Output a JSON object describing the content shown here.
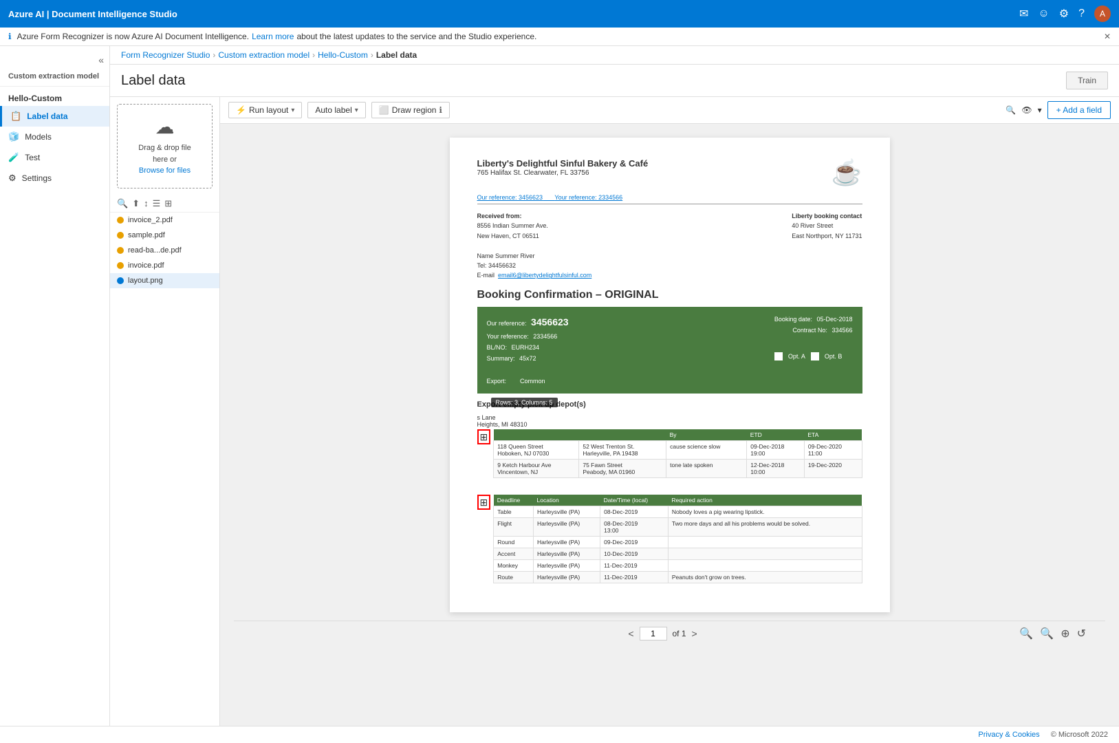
{
  "app": {
    "title": "Azure AI | Document Intelligence Studio",
    "top_icons": [
      "📧",
      "😊",
      "⚙",
      "?"
    ]
  },
  "notification": {
    "info_icon": "ℹ",
    "text": "Azure Form Recognizer is now Azure AI Document Intelligence.",
    "link_text": "Learn more",
    "link_suffix": "about the latest updates to the service and the Studio experience."
  },
  "breadcrumb": {
    "items": [
      "Form Recognizer Studio",
      "Custom extraction model",
      "Hello-Custom",
      "Label data"
    ]
  },
  "page": {
    "title": "Label data",
    "train_btn": "Train"
  },
  "sidebar": {
    "collapse_icon": "«",
    "section_label": "Custom extraction model",
    "project_name": "Hello-Custom",
    "nav_items": [
      {
        "id": "label-data",
        "label": "Label data",
        "icon": "📋",
        "active": true
      },
      {
        "id": "models",
        "label": "Models",
        "icon": "🧊",
        "active": false
      },
      {
        "id": "test",
        "label": "Test",
        "icon": "🧪",
        "active": false
      },
      {
        "id": "settings",
        "label": "Settings",
        "icon": "⚙",
        "active": false
      }
    ]
  },
  "file_panel": {
    "upload": {
      "icon": "☁",
      "line1": "Drag & drop file",
      "line2": "here or",
      "link": "Browse for files"
    },
    "tools": [
      "🔍",
      "⬆",
      "↕",
      "☰",
      "⊞"
    ],
    "files": [
      {
        "name": "invoice_2.pdf",
        "dot": "orange",
        "active": false
      },
      {
        "name": "sample.pdf",
        "dot": "orange",
        "active": false
      },
      {
        "name": "read-ba...de.pdf",
        "dot": "orange",
        "active": false
      },
      {
        "name": "invoice.pdf",
        "dot": "orange",
        "active": false
      },
      {
        "name": "layout.png",
        "dot": "blue",
        "active": true
      }
    ]
  },
  "toolbar": {
    "run_layout_btn": "Run layout",
    "auto_label_btn": "Auto label",
    "draw_region_btn": "Draw region",
    "info_icon": "ℹ",
    "chevron": "▾",
    "search_icon": "🔍",
    "eye_icon": "👁",
    "add_field_btn": "+ Add a field"
  },
  "document": {
    "company_name": "Liberty's Delightful Sinful Bakery & Café",
    "address": "765 Halifax St. Clearwater, FL 33756",
    "our_ref_label": "Our reference: 3456623",
    "your_ref_label": "Your reference: 2334566",
    "received_from": "Received from:",
    "from_addr1": "8556 Indian Summer Ave.",
    "from_addr2": "New Haven, CT 06511",
    "name_label": "Name Summer River",
    "tel_label": "Tel: 34456632",
    "email_label": "E-mail",
    "email_link": "email6@libertydelightfulsinful.com",
    "liberty_contact": "Liberty booking contact",
    "liberty_addr1": "40 River Street",
    "liberty_addr2": "East Northport, NY 11731",
    "booking_title": "Booking Confirmation – ORIGINAL",
    "green_box": {
      "our_ref_label": "Our reference:",
      "our_ref_val": "3456623",
      "your_ref_label": "Your reference:",
      "your_ref_val": "2334566",
      "bl_no_label": "BL/NO:",
      "bl_no_val": "EURH234",
      "summary_label": "Summary:",
      "summary_val": "45x72",
      "booking_date_label": "Booking date:",
      "booking_date_val": "05-Dec-2018",
      "contract_no_label": "Contract No:",
      "contract_no_val": "334566",
      "export_label": "Export:",
      "export_val": "Common",
      "opt_a": "Opt. A",
      "opt_b": "Opt. B"
    },
    "export_section": "Export empty pick up depot(s)",
    "tooltip_text": "Rows: 3, Columns: 5",
    "table1": {
      "headers": [
        "",
        "",
        "By",
        "ETD",
        "ETA"
      ],
      "rows": [
        [
          "118 Queen Street\nHoboken, NJ 07030",
          "52 West Trenton St.\nHarleyville, PA 19438",
          "cause science slow",
          "09-Dec-2018\n19:00",
          "09-Dec-2020\n11:00"
        ],
        [
          "9 Ketch Harbour Ave\nVincentown, NJ",
          "75 Fawn Street\nPeabody, MA 01960",
          "tone late spoken",
          "12-Dec-2018\n10:00",
          "19-Dec-2020"
        ]
      ]
    },
    "table2": {
      "headers": [
        "Deadline",
        "Location",
        "Date/Time (local)",
        "Required action"
      ],
      "rows": [
        [
          "Table",
          "Harleysville (PA)",
          "08-Dec-2019",
          "Nobody loves a pig wearing lipstick."
        ],
        [
          "Flight",
          "Harleysville (PA)",
          "08-Dec-2019\n13:00",
          "Two more days and all his problems would be solved."
        ],
        [
          "Round",
          "Harleysville (PA)",
          "09-Dec-2019",
          ""
        ],
        [
          "Accent",
          "Harleysville (PA)",
          "10-Dec-2019",
          ""
        ],
        [
          "Monkey",
          "Harleysville (PA)",
          "11-Dec-2019",
          ""
        ],
        [
          "Route",
          "Harleysville (PA)",
          "11-Dec-2019",
          "Peanuts don't grow on trees."
        ]
      ]
    },
    "s_lane": "s Lane",
    "heights_mi": "Heights, MI 48310"
  },
  "pagination": {
    "current_page": "1",
    "total": "of 1",
    "prev_icon": "<",
    "next_icon": ">"
  },
  "footer": {
    "privacy": "Privacy & Cookies",
    "copyright": "© Microsoft 2022"
  }
}
